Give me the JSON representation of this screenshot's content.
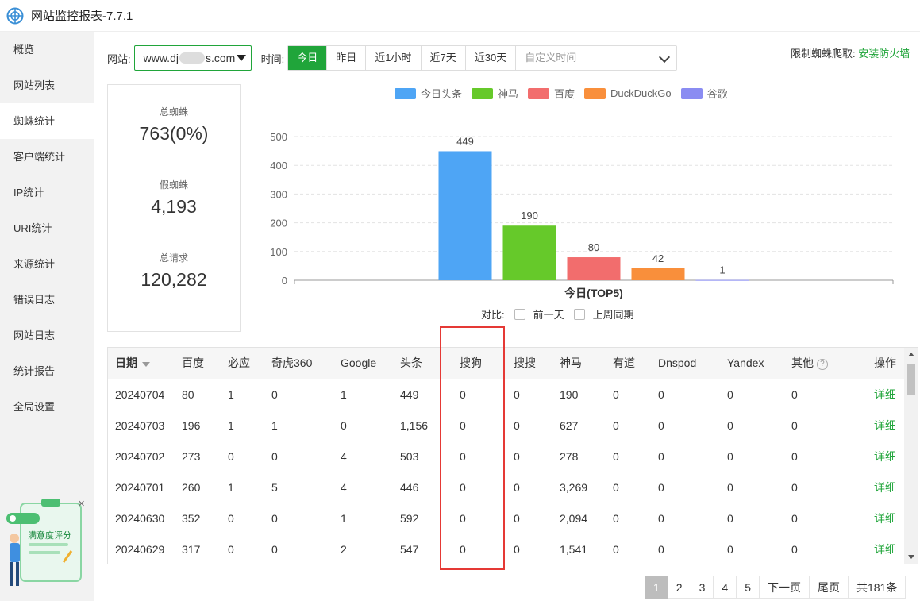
{
  "app": {
    "title": "网站监控报表-7.7.1"
  },
  "sidebar": {
    "items": [
      {
        "label": "概览"
      },
      {
        "label": "网站列表"
      },
      {
        "label": "蜘蛛统计",
        "active": true
      },
      {
        "label": "客户端统计"
      },
      {
        "label": "IP统计"
      },
      {
        "label": "URI统计"
      },
      {
        "label": "来源统计"
      },
      {
        "label": "错误日志"
      },
      {
        "label": "网站日志"
      },
      {
        "label": "统计报告"
      },
      {
        "label": "全局设置"
      }
    ]
  },
  "survey": {
    "label": "满意度评分"
  },
  "toolbar": {
    "site_label": "网站:",
    "site_value_prefix": "www.dj",
    "site_value_suffix": "s.com",
    "time_label": "时间:",
    "time_buttons": [
      {
        "label": "今日",
        "active": true
      },
      {
        "label": "昨日"
      },
      {
        "label": "近1小时"
      },
      {
        "label": "近7天"
      },
      {
        "label": "近30天"
      }
    ],
    "custom_time_placeholder": "自定义时间",
    "limit_label": "限制蜘蛛爬取:",
    "firewall_link": "安装防火墙"
  },
  "stats": {
    "total_spider_label": "总蜘蛛",
    "total_spider_value": "763(0%)",
    "fake_spider_label": "假蜘蛛",
    "fake_spider_value": "4,193",
    "total_requests_label": "总请求",
    "total_requests_value": "120,282"
  },
  "compare": {
    "label": "对比:",
    "prev_day": "前一天",
    "last_week": "上周同期"
  },
  "chart_data": {
    "type": "bar",
    "categories": [
      "今日(TOP5)"
    ],
    "xlabel": "今日(TOP5)",
    "ylim": [
      0,
      500
    ],
    "yticks": [
      0,
      100,
      200,
      300,
      400,
      500
    ],
    "grid": true,
    "legend_position": "top",
    "series": [
      {
        "name": "今日头条",
        "values": [
          449
        ],
        "color": "#4ea5f5"
      },
      {
        "name": "神马",
        "values": [
          190
        ],
        "color": "#66c92a"
      },
      {
        "name": "百度",
        "values": [
          80
        ],
        "color": "#f26d6d"
      },
      {
        "name": "DuckDuckGo",
        "values": [
          42
        ],
        "color": "#f98f3b"
      },
      {
        "name": "谷歌",
        "values": [
          1
        ],
        "color": "#8a8cf2"
      }
    ]
  },
  "table": {
    "columns": [
      "日期",
      "百度",
      "必应",
      "奇虎360",
      "Google",
      "头条",
      "搜狗",
      "搜搜",
      "神马",
      "有道",
      "Dnspod",
      "Yandex",
      "其他",
      "操作"
    ],
    "help_glyph": "?",
    "action_label": "详细",
    "rows": [
      [
        "20240704",
        "80",
        "1",
        "0",
        "1",
        "449",
        "0",
        "0",
        "190",
        "0",
        "0",
        "0",
        "0"
      ],
      [
        "20240703",
        "196",
        "1",
        "1",
        "0",
        "1,156",
        "0",
        "0",
        "627",
        "0",
        "0",
        "0",
        "0"
      ],
      [
        "20240702",
        "273",
        "0",
        "0",
        "4",
        "503",
        "0",
        "0",
        "278",
        "0",
        "0",
        "0",
        "0"
      ],
      [
        "20240701",
        "260",
        "1",
        "5",
        "4",
        "446",
        "0",
        "0",
        "3,269",
        "0",
        "0",
        "0",
        "0"
      ],
      [
        "20240630",
        "352",
        "0",
        "0",
        "1",
        "592",
        "0",
        "0",
        "2,094",
        "0",
        "0",
        "0",
        "0"
      ],
      [
        "20240629",
        "317",
        "0",
        "0",
        "2",
        "547",
        "0",
        "0",
        "1,541",
        "0",
        "0",
        "0",
        "0"
      ]
    ]
  },
  "pagination": {
    "pages": [
      "1",
      "2",
      "3",
      "4",
      "5"
    ],
    "next": "下一页",
    "last": "尾页",
    "total": "共181条"
  }
}
